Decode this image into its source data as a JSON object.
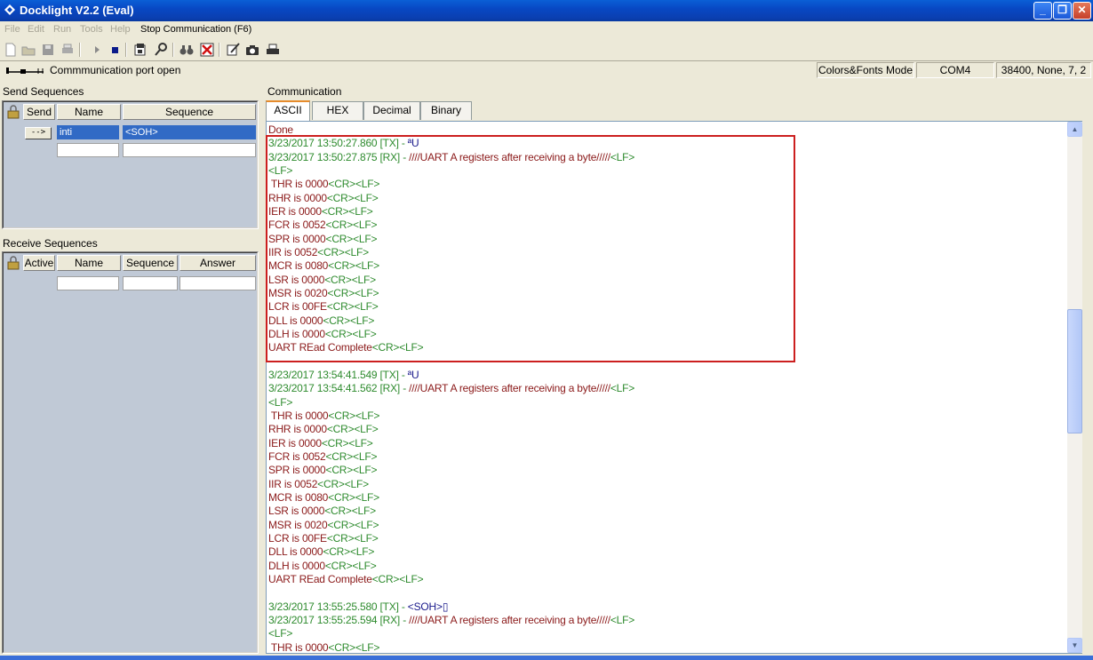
{
  "window": {
    "title": "Docklight V2.2 (Eval)",
    "minimize": "_",
    "maximize": "❐",
    "close": "✕"
  },
  "menu": {
    "file": "File",
    "edit": "Edit",
    "run": "Run",
    "tools": "Tools",
    "help": "Help",
    "stop": "Stop Communication  (F6)"
  },
  "status": {
    "message": "Commmunication port open",
    "mode": "Colors&Fonts Mode",
    "port": "COM4",
    "settings": "38400, None, 7, 2"
  },
  "send": {
    "title": "Send Sequences",
    "headers": {
      "send": "Send",
      "name": "Name",
      "sequence": "Sequence"
    },
    "button": "-->",
    "row": {
      "name": "inti",
      "sequence": "<SOH>"
    }
  },
  "receive": {
    "title": "Receive Sequences",
    "headers": {
      "active": "Active",
      "name": "Name",
      "sequence": "Sequence",
      "answer": "Answer"
    }
  },
  "communication": {
    "title": "Communication",
    "tabs": [
      "ASCII",
      "HEX",
      "Decimal",
      "Binary"
    ],
    "first_line": "Done",
    "block1": {
      "tx_head": "3/23/2017 13:50:27.860 [TX] - ",
      "tx_data": "ªU",
      "rx_head": "3/23/2017 13:50:27.875 [RX] - ",
      "rx_data": "////UART A registers after receiving a byte/////"
    },
    "block2": {
      "tx_head": "3/23/2017 13:54:41.549 [TX] - ",
      "tx_data": "ªU",
      "rx_head": "3/23/2017 13:54:41.562 [RX] - ",
      "rx_data": "////UART A registers after receiving a byte/////"
    },
    "block3": {
      "tx_head": "3/23/2017 13:55:25.580 [TX] - ",
      "tx_data": "<SOH>",
      "tx_tail": "▯",
      "rx_head": "3/23/2017 13:55:25.594 [RX] - ",
      "rx_data": "////UART A registers after receiving a byte/////"
    },
    "lf": "<LF>",
    "crlf": "<CR><LF>",
    "regs": [
      " THR is 0000",
      "RHR is 0000",
      "IER is 0000",
      "FCR is 0052",
      "SPR is 0000",
      "IIR is 0052",
      "MCR is 0080",
      "LSR is 0000",
      "MSR is 0020",
      "LCR is 00FE",
      "DLL is 0000",
      "DLH is 0000"
    ],
    "complete": "UART REad Complete"
  },
  "scroll": {
    "up": "▲",
    "down": "▼"
  }
}
